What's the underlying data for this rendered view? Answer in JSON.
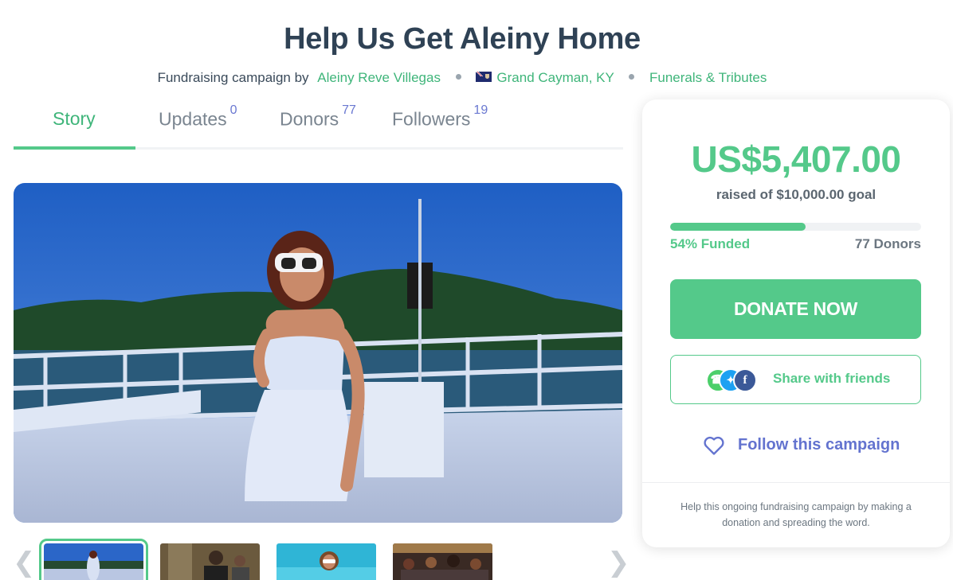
{
  "campaign": {
    "title": "Help Us Get Aleiny Home",
    "byline_prefix": "Fundraising campaign by",
    "organizer": "Aleiny Reve Villegas",
    "location": "Grand Cayman, KY",
    "category": "Funerals & Tributes"
  },
  "tabs": [
    {
      "label": "Story",
      "count": ""
    },
    {
      "label": "Updates",
      "count": "0"
    },
    {
      "label": "Donors",
      "count": "77"
    },
    {
      "label": "Followers",
      "count": "19"
    }
  ],
  "gallery": {
    "thumbnail_count": 4,
    "selected_index": 0
  },
  "donation_card": {
    "amount": "US$5,407.00",
    "goal_text": "raised of $10,000.00 goal",
    "progress_percent": 54,
    "funded_text": "54% Funded",
    "donors_text": "77 Donors",
    "donate_label": "DONATE NOW",
    "share_label": "Share with friends",
    "follow_label": "Follow this campaign",
    "note": "Help this ongoing fundraising campaign by making a donation and spreading the word."
  },
  "colors": {
    "accent_green": "#54c98a",
    "link_green": "#3fb57a",
    "accent_blue": "#6373cf",
    "title_dark": "#2f4255"
  },
  "icons": [
    "flag-cayman-icon",
    "chevron-left-icon",
    "chevron-right-icon",
    "whatsapp-icon",
    "twitter-icon",
    "facebook-icon",
    "heart-icon"
  ]
}
